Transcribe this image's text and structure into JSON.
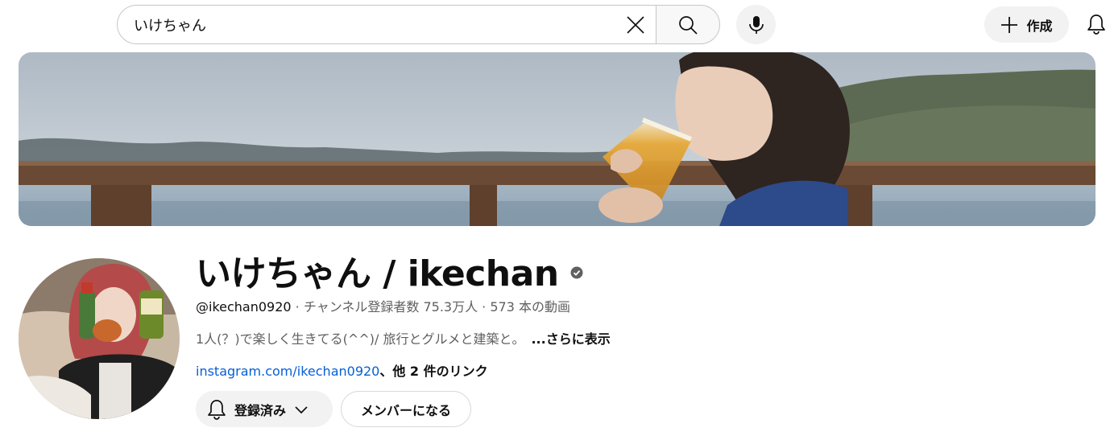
{
  "search": {
    "query": "いけちゃん"
  },
  "header": {
    "create_label": "作成"
  },
  "channel": {
    "name": "いけちゃん / ikechan",
    "handle": "@ikechan0920",
    "separator1": " · ",
    "subscribers": "チャンネル登録者数 75.3万人",
    "separator2": " · ",
    "videos": "573 本の動画",
    "description": "1人(？)で楽しく生きてる(^^)/ 旅行とグルメと建築と。",
    "more_label": "...さらに表示",
    "link_text": "instagram.com/ikechan0920",
    "other_links": "、他 2 件のリンク"
  },
  "actions": {
    "subscribed_label": "登録済み",
    "member_label": "メンバーになる"
  },
  "colors": {
    "link": "#065fd4",
    "button_bg": "#f2f2f2",
    "muted_text": "#606060"
  }
}
